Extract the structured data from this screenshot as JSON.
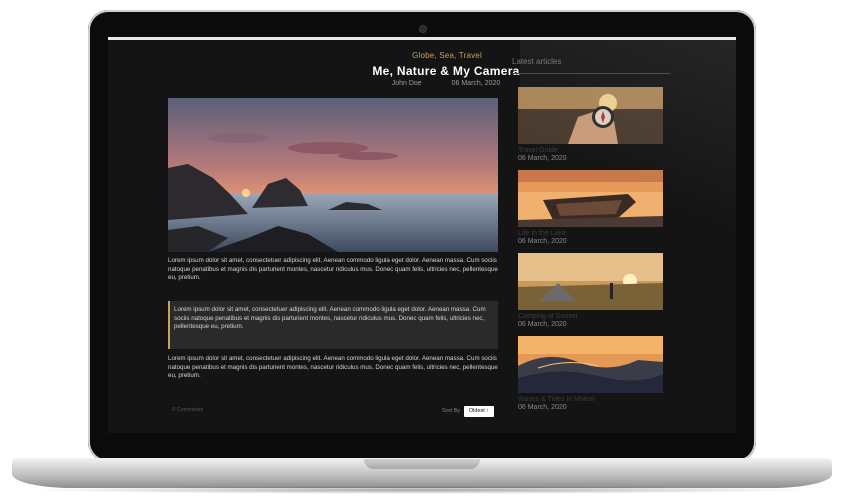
{
  "article": {
    "category": "Globe, Sea, Travel",
    "title": "Me, Nature & My Camera",
    "author": "John Doe",
    "date": "06 March, 2020",
    "paragraph1": "Lorem ipsum dolor sit amet, consectetuer adipiscing elit. Aenean commodo ligula eget dolor. Aenean massa. Cum sociis natoque penatibus et magnis dis parturient montes, nascetur ridiculus mus. Donec quam felis, ultricies nec, pellentesque eu, pretium.",
    "quote": "Lorem ipsum dolor sit amet, consectetuer adipiscing elit. Aenean commodo ligula eget dolor. Aenean massa. Cum sociis natoque penatibus et magnis dis parturient montes, nascetur ridiculus mus. Donec quam felis, ultricies nec, pellentesque eu, pretium.",
    "paragraph3": "Lorem ipsum dolor sit amet, consectetuer adipiscing elit. Aenean commodo ligula eget dolor. Aenean massa. Cum sociis natoque penatibus et magnis dis parturient montes, nascetur ridiculus mus. Donec quam felis, ultricies nec, pellentesque eu, pretium."
  },
  "footer": {
    "comments": "0 Comments",
    "sort_label": "Sort By",
    "sort_value": "Oldest ↑"
  },
  "sidebar": {
    "title": "Latest articles",
    "articles": [
      {
        "title": "Travel Guide",
        "date": "06 March, 2020",
        "image": "compass-in-hand-photo"
      },
      {
        "title": "Life In the Lake",
        "date": "06 March, 2020",
        "image": "boat-on-lake-photo"
      },
      {
        "title": "Camping at Sunset",
        "date": "06 March, 2020",
        "image": "tent-at-sunset-photo"
      },
      {
        "title": "Waves & Tides In Motion",
        "date": "06 March, 2020",
        "image": "ocean-wave-photo"
      }
    ]
  },
  "colors": {
    "accent": "#c8a15a",
    "screen_bg": "#141414",
    "quote_bg": "#2a2a2a"
  }
}
